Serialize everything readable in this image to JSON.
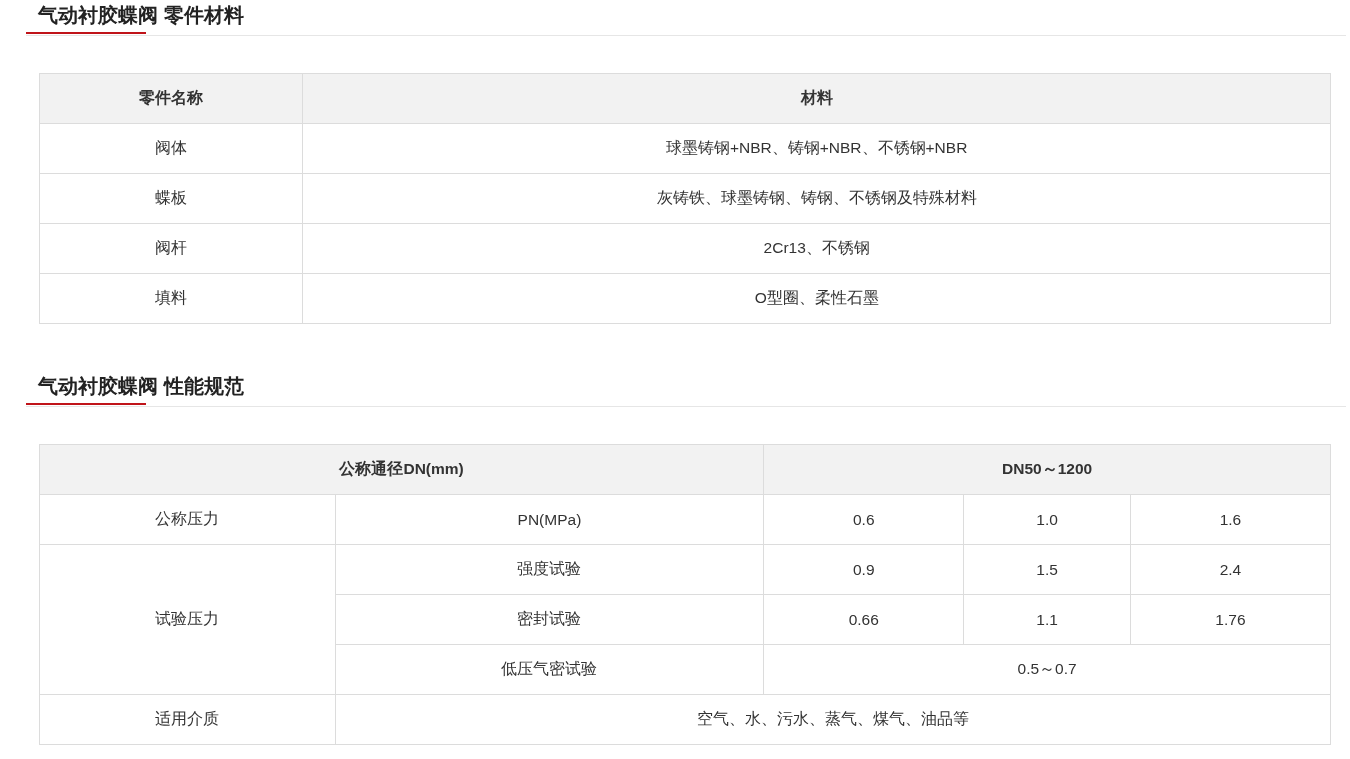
{
  "materials": {
    "title": "气动衬胶蝶阀 零件材料",
    "columns": [
      "零件名称",
      "材料"
    ],
    "rows": [
      {
        "part": "阀体",
        "material": "球墨铸钢+NBR、铸钢+NBR、不锈钢+NBR"
      },
      {
        "part": "蝶板",
        "material": "灰铸铁、球墨铸钢、铸钢、不锈钢及特殊材料"
      },
      {
        "part": "阀杆",
        "material": "2Cr13、不锈钢"
      },
      {
        "part": "填料",
        "material": "O型圈、柔性石墨"
      }
    ]
  },
  "performance": {
    "title": "气动衬胶蝶阀 性能规范",
    "header": [
      "公称通径DN(mm)",
      "DN50～1200"
    ],
    "nominal": {
      "label": "公称压力",
      "param": "PN(MPa)",
      "values": [
        "0.6",
        "1.0",
        "1.6"
      ]
    },
    "test": {
      "label": "试验压力",
      "rows": [
        {
          "param": "强度试验",
          "values": [
            "0.9",
            "1.5",
            "2.4"
          ]
        },
        {
          "param": "密封试验",
          "values": [
            "0.66",
            "1.1",
            "1.76"
          ]
        },
        {
          "param": "低压气密试验",
          "values": [
            "0.5～0.7"
          ]
        }
      ]
    },
    "medium": {
      "label": "适用介质",
      "value": "空气、水、污水、蒸气、煤气、油品等"
    }
  }
}
